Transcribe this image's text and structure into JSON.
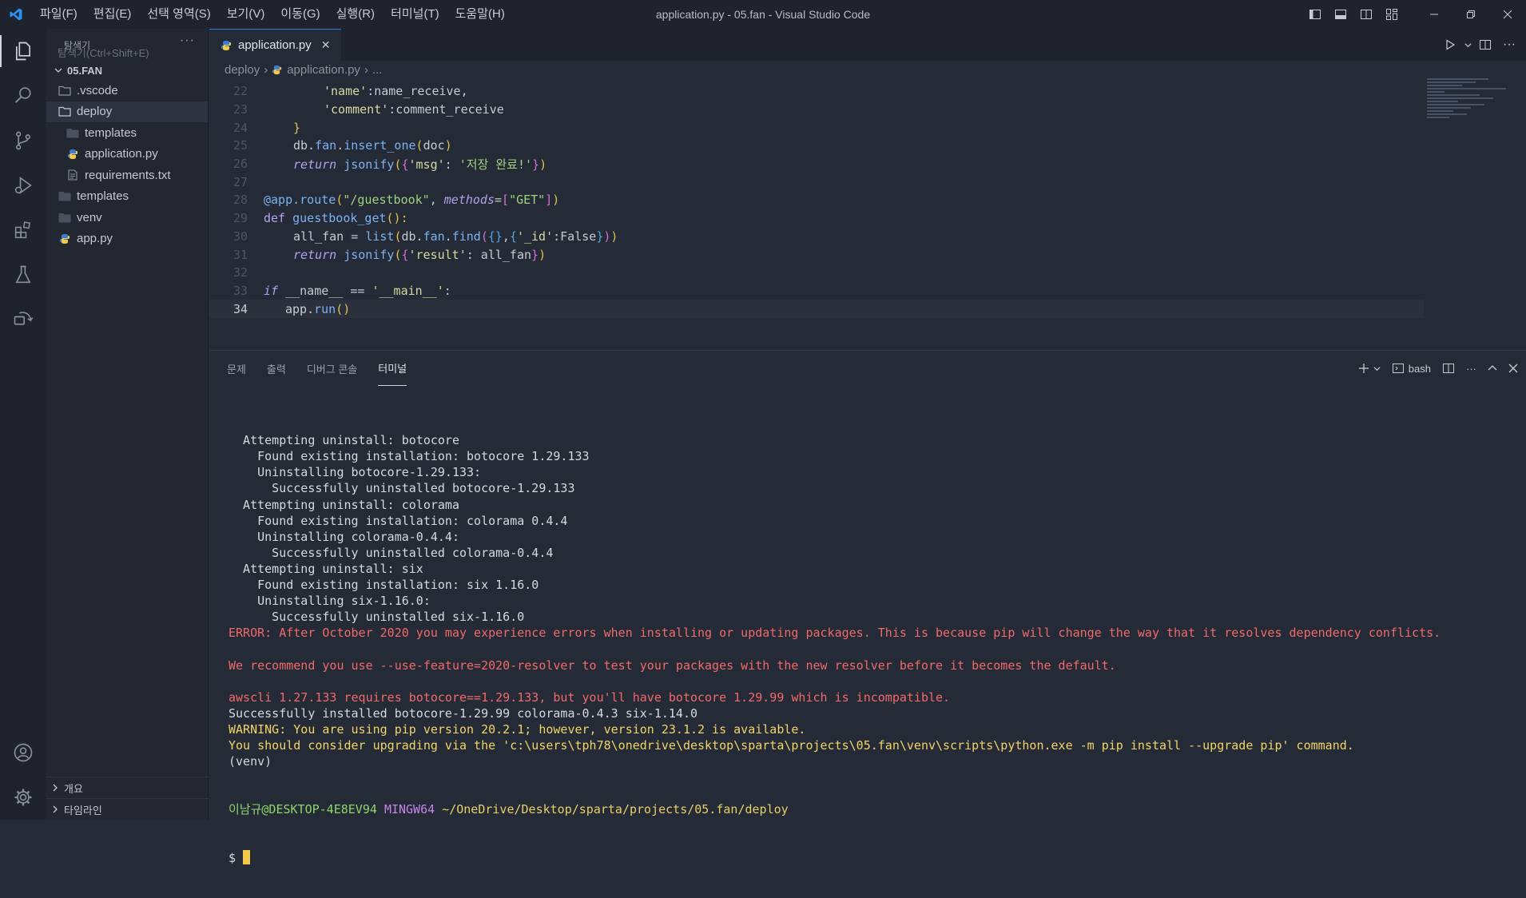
{
  "titlebar": {
    "menu": [
      "파일(F)",
      "편집(E)",
      "선택 영역(S)",
      "보기(V)",
      "이동(G)",
      "실행(R)",
      "터미널(T)",
      "도움말(H)"
    ],
    "window_title": "application.py - 05.fan - Visual Studio Code"
  },
  "sidebar": {
    "title": "탐색기",
    "hint": "탐색기(Ctrl+Shift+E)",
    "root": "05.FAN",
    "items": [
      {
        "label": ".vscode",
        "icon": "folder-icon"
      },
      {
        "label": "deploy",
        "icon": "folder-open-icon"
      },
      {
        "label": "templates",
        "icon": "folder-icon"
      },
      {
        "label": "application.py",
        "icon": "python-icon"
      },
      {
        "label": "requirements.txt",
        "icon": "file-icon"
      },
      {
        "label": "templates",
        "icon": "folder-icon"
      },
      {
        "label": "venv",
        "icon": "folder-icon"
      },
      {
        "label": "app.py",
        "icon": "python-icon"
      }
    ],
    "sections": [
      "개요",
      "타임라인"
    ]
  },
  "editor": {
    "tab_label": "application.py",
    "breadcrumb": [
      "deploy",
      "application.py",
      "..."
    ],
    "line_numbers": [
      "22",
      "23",
      "24",
      "25",
      "26",
      "27",
      "28",
      "29",
      "30",
      "31",
      "32",
      "33",
      "34"
    ],
    "code": [
      "'name':name_receive,",
      "'comment':comment_receive",
      "}",
      "db.fan.insert_one(doc)",
      "return jsonify({'msg': '저장 완료!'})",
      "",
      "@app.route(\"/guestbook\", methods=[\"GET\"])",
      "def guestbook_get():",
      "all_fan = list(db.fan.find({},{'_id':False}))",
      "return jsonify({'result': all_fan})",
      "",
      "if __name__ == '__main__':",
      "app.run()"
    ]
  },
  "panel": {
    "tabs": [
      "문제",
      "출력",
      "디버그 콘솔",
      "터미널"
    ],
    "shell_label": "bash",
    "terminal": [
      {
        "text": "  Attempting uninstall: botocore",
        "kind": "normal"
      },
      {
        "text": "    Found existing installation: botocore 1.29.133",
        "kind": "normal"
      },
      {
        "text": "    Uninstalling botocore-1.29.133:",
        "kind": "normal"
      },
      {
        "text": "      Successfully uninstalled botocore-1.29.133",
        "kind": "normal"
      },
      {
        "text": "  Attempting uninstall: colorama",
        "kind": "normal"
      },
      {
        "text": "    Found existing installation: colorama 0.4.4",
        "kind": "normal"
      },
      {
        "text": "    Uninstalling colorama-0.4.4:",
        "kind": "normal"
      },
      {
        "text": "      Successfully uninstalled colorama-0.4.4",
        "kind": "normal"
      },
      {
        "text": "  Attempting uninstall: six",
        "kind": "normal"
      },
      {
        "text": "    Found existing installation: six 1.16.0",
        "kind": "normal"
      },
      {
        "text": "    Uninstalling six-1.16.0:",
        "kind": "normal"
      },
      {
        "text": "      Successfully uninstalled six-1.16.0",
        "kind": "normal"
      },
      {
        "text": "ERROR: After October 2020 you may experience errors when installing or updating packages. This is because pip will change the way that it resolves dependency conflicts.",
        "kind": "err"
      },
      {
        "text": "",
        "kind": "normal"
      },
      {
        "text": "We recommend you use --use-feature=2020-resolver to test your packages with the new resolver before it becomes the default.",
        "kind": "err"
      },
      {
        "text": "",
        "kind": "normal"
      },
      {
        "text": "awscli 1.27.133 requires botocore==1.29.133, but you'll have botocore 1.29.99 which is incompatible.",
        "kind": "err"
      },
      {
        "text": "Successfully installed botocore-1.29.99 colorama-0.4.3 six-1.14.0",
        "kind": "normal"
      },
      {
        "text": "WARNING: You are using pip version 20.2.1; however, version 23.1.2 is available.",
        "kind": "warn"
      },
      {
        "text": "You should consider upgrading via the 'c:\\users\\tph78\\onedrive\\desktop\\sparta\\projects\\05.fan\\venv\\scripts\\python.exe -m pip install --upgrade pip' command.",
        "kind": "warn"
      },
      {
        "text": "(venv)",
        "kind": "normal"
      }
    ],
    "prompt_user": "이남규@DESKTOP-4E8EV94",
    "prompt_host": "MINGW64",
    "prompt_path": "~/OneDrive/Desktop/sparta/projects/05.fan/deploy",
    "prompt_symbol": "$"
  }
}
